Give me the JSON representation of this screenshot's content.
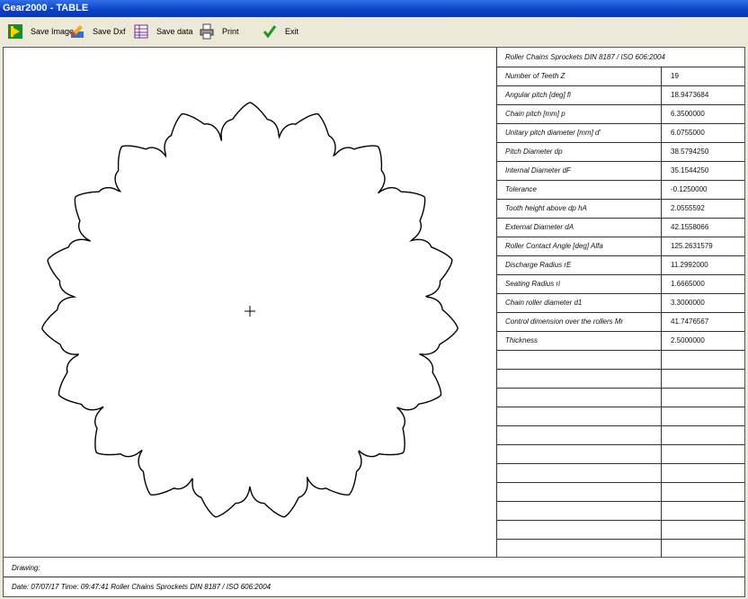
{
  "window": {
    "title": "Gear2000 - TABLE"
  },
  "toolbar": {
    "save_image": "Save Image",
    "save_dxf": "Save Dxf",
    "save_data": "Save data",
    "print": "Print",
    "exit": "Exit"
  },
  "table": {
    "header": "Roller Chains Sprockets DIN 8187 / ISO 606:2004",
    "rows": [
      {
        "label": "Number of Teeth  Z",
        "value": "19"
      },
      {
        "label": "Angular pitch [deg]  fi",
        "value": "18.9473684"
      },
      {
        "label": "Chain pitch [mm]  p",
        "value": "6.3500000"
      },
      {
        "label": "Unitary pitch diameter [mm]  d'",
        "value": "6.0755000"
      },
      {
        "label": "Pitch Diameter  dp",
        "value": "38.5794250"
      },
      {
        "label": "Internal Diameter  dF",
        "value": "35.1544250"
      },
      {
        "label": "Tolerance",
        "value": "-0.1250000"
      },
      {
        "label": "Tooth height above dp  hA",
        "value": "2.0555592"
      },
      {
        "label": "External Diameter  dA",
        "value": "42.1558066"
      },
      {
        "label": "Roller Contact Angle [deg]  Alfa",
        "value": "125.2631579"
      },
      {
        "label": "Discharge Radius  rE",
        "value": "11.2992000"
      },
      {
        "label": "Seating Radius  ri",
        "value": "1.6665000"
      },
      {
        "label": "Chain roller diameter  d1",
        "value": "3.3000000"
      },
      {
        "label": "Control dimension over the rollers  Mr",
        "value": "41.7476567"
      },
      {
        "label": "Thickness",
        "value": "2.5000000"
      }
    ],
    "empty_rows": 11
  },
  "gear": {
    "teeth": 19
  },
  "footer": {
    "drawing_label": "Drawing:",
    "info": "Date: 07/07/17 Time: 09:47:41    Roller Chains Sprockets DIN 8187 / ISO 606:2004"
  }
}
